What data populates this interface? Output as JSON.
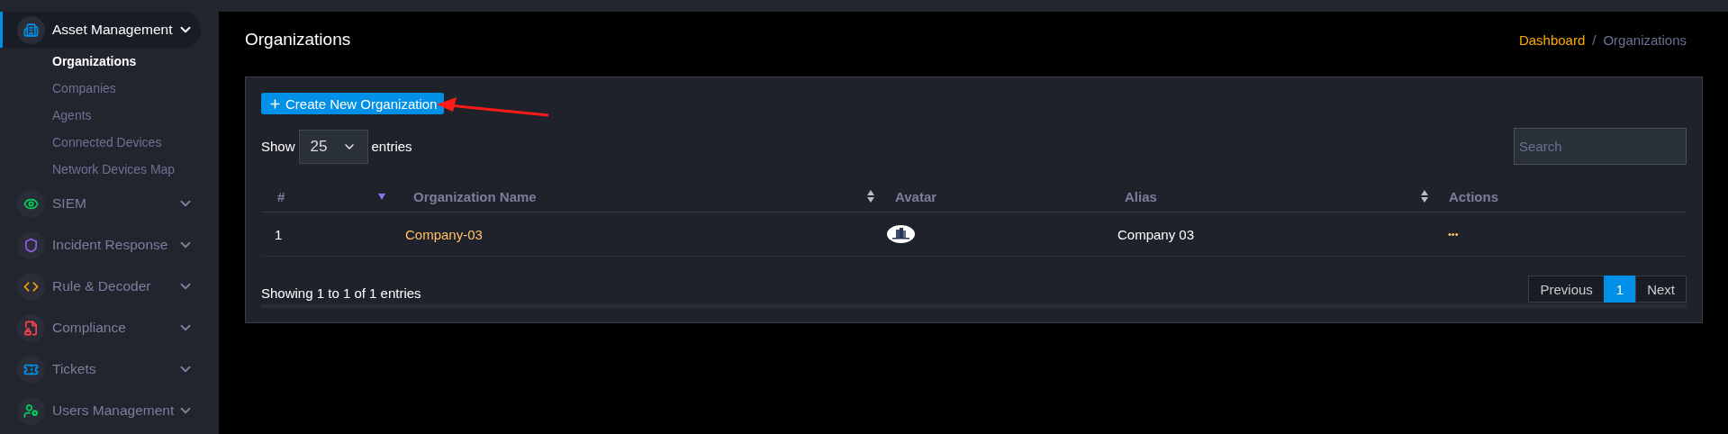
{
  "sidebar": {
    "groups": [
      {
        "label": "Asset Management",
        "color": "#0090e7",
        "expanded": true,
        "selected": true,
        "children": [
          {
            "label": "Organizations",
            "selected": true
          },
          {
            "label": "Companies",
            "selected": false
          },
          {
            "label": "Agents",
            "selected": false
          },
          {
            "label": "Connected Devices",
            "selected": false
          },
          {
            "label": "Network Devices Map",
            "selected": false
          }
        ]
      },
      {
        "label": "SIEM",
        "color": "#00d25b",
        "expanded": false,
        "selected": false
      },
      {
        "label": "Incident Response",
        "color": "#8f5fe8",
        "expanded": false,
        "selected": false
      },
      {
        "label": "Rule & Decoder",
        "color": "#ffab00",
        "expanded": false,
        "selected": false
      },
      {
        "label": "Compliance",
        "color": "#fc424a",
        "expanded": false,
        "selected": false
      },
      {
        "label": "Tickets",
        "color": "#0090e7",
        "expanded": false,
        "selected": false
      },
      {
        "label": "Users Management",
        "color": "#00d25b",
        "expanded": false,
        "selected": false
      }
    ]
  },
  "page": {
    "title": "Organizations",
    "breadcrumb_separator": "/",
    "breadcrumb": [
      {
        "label": "Dashboard",
        "kind": "link"
      },
      {
        "label": "Organizations",
        "kind": "current"
      }
    ]
  },
  "card": {
    "create_button": "Create New Organization",
    "length": {
      "before": "Show",
      "value": "25",
      "after": "entries"
    },
    "search": {
      "placeholder": "Search"
    },
    "table": {
      "columns": [
        {
          "label": "#",
          "kind": "sorted"
        },
        {
          "label": "Organization Name",
          "kind": "sortable"
        },
        {
          "label": "Avatar",
          "kind": "plain"
        },
        {
          "label": "Alias",
          "kind": "sortable"
        },
        {
          "label": "Actions",
          "kind": "plain"
        }
      ],
      "rows": [
        {
          "number": "1",
          "name": "Company-03",
          "alias": "Company 03",
          "actions": "•••"
        }
      ]
    },
    "info": "Showing 1 to 1 of 1 entries",
    "pagination": [
      {
        "label": "Previous",
        "selected": false
      },
      {
        "label": "1",
        "selected": true
      },
      {
        "label": "Next",
        "selected": false
      }
    ]
  }
}
